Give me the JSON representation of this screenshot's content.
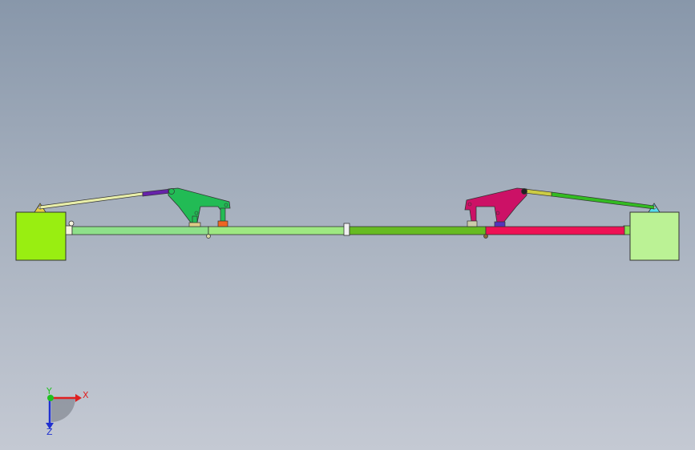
{
  "axes": {
    "x_label": "X",
    "y_label": "Y",
    "z_label": "Z",
    "x_color": "#e02020",
    "y_color": "#20c020",
    "z_color": "#2030d0"
  },
  "parts": {
    "left_block": "#99ee11",
    "right_block": "#bbf295",
    "beam_left": "#8ee08a",
    "beam_left_center": "#9ee882",
    "beam_right_center": "#66bb22",
    "beam_right": "#ee1155",
    "left_linkage": "#22bb55",
    "right_linkage": "#cc1166",
    "left_rod": "#e8eeaa",
    "right_rod": "#33bb22",
    "left_rod_sleeve": "#6622aa",
    "right_rod_sleeve": "#cccc44",
    "left_pivot": "#e8d040",
    "right_pivot": "#55ddee",
    "left_base_bracket": "#ee6622",
    "right_base_bracket": "#5533bb"
  }
}
